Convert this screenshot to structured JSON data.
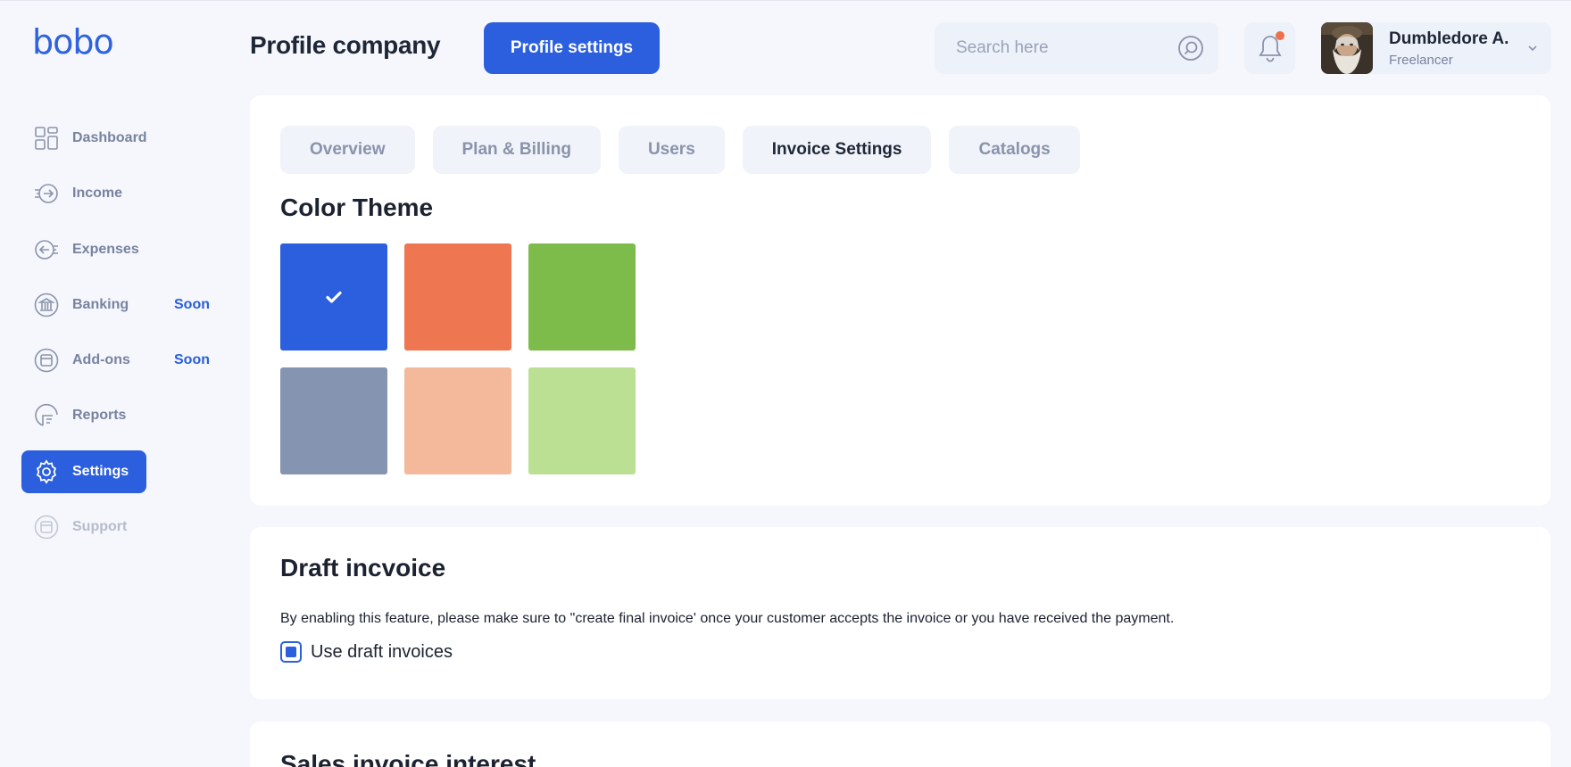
{
  "app": {
    "logo": "bobo"
  },
  "sidebar": {
    "items": [
      {
        "label": "Dashboard",
        "icon": "dashboard-icon",
        "badge": "",
        "state": "normal"
      },
      {
        "label": "Income",
        "icon": "income-icon",
        "badge": "",
        "state": "normal"
      },
      {
        "label": "Expenses",
        "icon": "expenses-icon",
        "badge": "",
        "state": "normal"
      },
      {
        "label": "Banking",
        "icon": "bank-icon",
        "badge": "Soon",
        "state": "normal"
      },
      {
        "label": "Add-ons",
        "icon": "addons-icon",
        "badge": "Soon",
        "state": "normal"
      },
      {
        "label": "Reports",
        "icon": "reports-icon",
        "badge": "",
        "state": "normal"
      },
      {
        "label": "Settings",
        "icon": "gear-icon",
        "badge": "",
        "state": "active"
      },
      {
        "label": "Support",
        "icon": "support-icon",
        "badge": "",
        "state": "muted"
      }
    ]
  },
  "header": {
    "title": "Profile company",
    "profile_button": "Profile settings",
    "search_placeholder": "Search here",
    "notifications": {
      "icon": "bell-icon",
      "has_unread": true
    },
    "user": {
      "name": "Dumbledore A.",
      "role": "Freelancer"
    }
  },
  "tabs": [
    {
      "label": "Overview",
      "active": false
    },
    {
      "label": "Plan & Billing",
      "active": false
    },
    {
      "label": "Users",
      "active": false
    },
    {
      "label": "Invoice Settings",
      "active": true
    },
    {
      "label": "Catalogs",
      "active": false
    }
  ],
  "color_theme": {
    "title": "Color Theme",
    "swatches": [
      {
        "color": "#2c5fde",
        "selected": true
      },
      {
        "color": "#ee7650",
        "selected": false
      },
      {
        "color": "#7dbc4a",
        "selected": false
      },
      {
        "color": "#8594b0",
        "selected": false
      },
      {
        "color": "#f4b99a",
        "selected": false
      },
      {
        "color": "#bbe094",
        "selected": false
      }
    ]
  },
  "draft_invoice": {
    "title": "Draft incvoice",
    "description": "By enabling this feature, please make sure to \"create final invoice' once your customer accepts the invoice or you have received the payment.",
    "checkbox_label": "Use draft invoices",
    "checked": true
  },
  "sales_interest": {
    "title": "Sales invoice interest"
  },
  "colors": {
    "accent": "#2c5fde",
    "notification_dot": "#ee6f4a",
    "nav_text": "#7883a0",
    "background": "#f5f7fc"
  }
}
